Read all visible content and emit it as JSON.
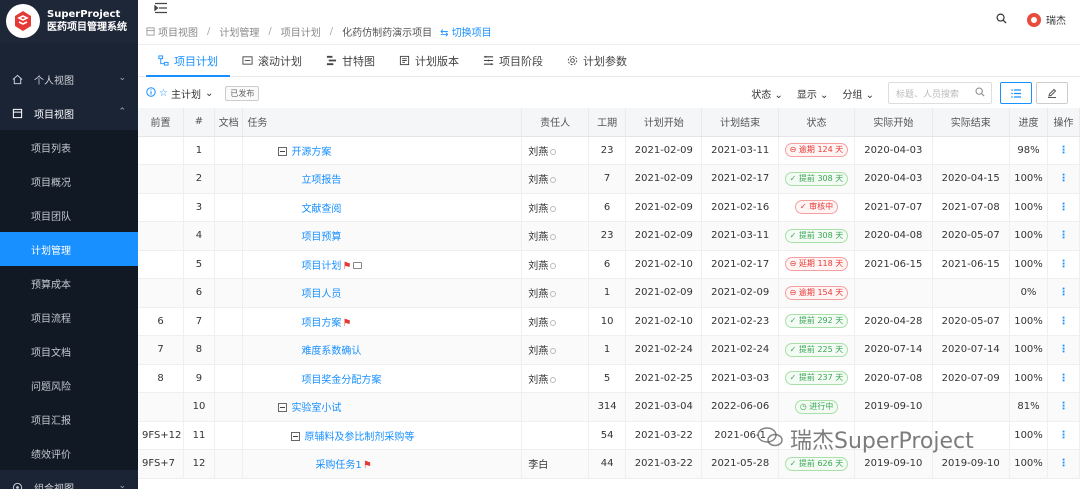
{
  "brand": {
    "name": "SuperProject",
    "subtitle": "医药项目管理系统"
  },
  "sidebar": {
    "groups": [
      {
        "label": "个人视图"
      },
      {
        "label": "项目视图"
      }
    ],
    "items": [
      {
        "label": "项目列表"
      },
      {
        "label": "项目概况"
      },
      {
        "label": "项目团队"
      },
      {
        "label": "计划管理"
      },
      {
        "label": "预算成本"
      },
      {
        "label": "项目流程"
      },
      {
        "label": "项目文档"
      },
      {
        "label": "问题风险"
      },
      {
        "label": "项目汇报"
      },
      {
        "label": "绩效评价"
      }
    ],
    "bottom_group": {
      "label": "组合视图"
    }
  },
  "breadcrumb": {
    "items": [
      "项目视图",
      "计划管理",
      "项目计划",
      "化药仿制药演示项目"
    ],
    "switch_label": "切换项目"
  },
  "user": {
    "name": "瑞杰"
  },
  "tabs": [
    {
      "label": "项目计划"
    },
    {
      "label": "滚动计划"
    },
    {
      "label": "甘特图"
    },
    {
      "label": "计划版本"
    },
    {
      "label": "项目阶段"
    },
    {
      "label": "计划参数"
    }
  ],
  "toolbar": {
    "plan_label": "主计划",
    "published_badge": "已发布",
    "status_filter": "状态",
    "display_filter": "显示",
    "group_filter": "分组",
    "search_placeholder": "标题、人员搜索"
  },
  "table": {
    "headers": {
      "pred": "前置",
      "num": "#",
      "doc": "文档",
      "task": "任务",
      "owner": "责任人",
      "duration": "工期",
      "plan_start": "计划开始",
      "plan_end": "计划结束",
      "status": "状态",
      "actual_start": "实际开始",
      "actual_end": "实际结束",
      "progress": "进度",
      "ops": "操作"
    },
    "rows": [
      {
        "pred": "",
        "num": "1",
        "task": "开源方案",
        "owner": "刘燕",
        "duration": "23",
        "plan_start": "2021-02-09",
        "plan_end": "2021-03-11",
        "status": "逾期 124 天",
        "status_color": "red",
        "actual_start": "2020-04-03",
        "actual_end": "",
        "progress": "98%"
      },
      {
        "pred": "",
        "num": "2",
        "task": "立项报告",
        "owner": "刘燕",
        "duration": "7",
        "plan_start": "2021-02-09",
        "plan_end": "2021-02-17",
        "status": "提前 308 天",
        "status_color": "green",
        "actual_start": "2020-04-03",
        "actual_end": "2020-04-15",
        "progress": "100%"
      },
      {
        "pred": "",
        "num": "3",
        "task": "文献查阅",
        "owner": "刘燕",
        "duration": "6",
        "plan_start": "2021-02-09",
        "plan_end": "2021-02-16",
        "status": "审核中",
        "status_color": "red",
        "actual_start": "2021-07-07",
        "actual_end": "2021-07-08",
        "progress": "100%"
      },
      {
        "pred": "",
        "num": "4",
        "task": "项目预算",
        "owner": "刘燕",
        "duration": "23",
        "plan_start": "2021-02-09",
        "plan_end": "2021-03-11",
        "status": "提前 308 天",
        "status_color": "green",
        "actual_start": "2020-04-08",
        "actual_end": "2020-05-07",
        "progress": "100%"
      },
      {
        "pred": "",
        "num": "5",
        "task": "项目计划",
        "owner": "刘燕",
        "duration": "6",
        "plan_start": "2021-02-10",
        "plan_end": "2021-02-17",
        "status": "延期 118 天",
        "status_color": "red",
        "actual_start": "2021-06-15",
        "actual_end": "2021-06-15",
        "progress": "100%"
      },
      {
        "pred": "",
        "num": "6",
        "task": "项目人员",
        "owner": "刘燕",
        "duration": "1",
        "plan_start": "2021-02-09",
        "plan_end": "2021-02-09",
        "status": "逾期 154 天",
        "status_color": "red",
        "actual_start": "",
        "actual_end": "",
        "progress": "0%"
      },
      {
        "pred": "6",
        "num": "7",
        "task": "项目方案",
        "owner": "刘燕",
        "duration": "10",
        "plan_start": "2021-02-10",
        "plan_end": "2021-02-23",
        "status": "提前 292 天",
        "status_color": "green",
        "actual_start": "2020-04-28",
        "actual_end": "2020-05-07",
        "progress": "100%"
      },
      {
        "pred": "7",
        "num": "8",
        "task": "难度系数确认",
        "owner": "刘燕",
        "duration": "1",
        "plan_start": "2021-02-24",
        "plan_end": "2021-02-24",
        "status": "提前 225 天",
        "status_color": "green",
        "actual_start": "2020-07-14",
        "actual_end": "2020-07-14",
        "progress": "100%"
      },
      {
        "pred": "8",
        "num": "9",
        "task": "项目奖金分配方案",
        "owner": "刘燕",
        "duration": "5",
        "plan_start": "2021-02-25",
        "plan_end": "2021-03-03",
        "status": "提前 237 天",
        "status_color": "green",
        "actual_start": "2020-07-08",
        "actual_end": "2020-07-09",
        "progress": "100%"
      },
      {
        "pred": "",
        "num": "10",
        "task": "实验室小试",
        "owner": "",
        "duration": "314",
        "plan_start": "2021-03-04",
        "plan_end": "2022-06-06",
        "status": "进行中",
        "status_color": "green",
        "actual_start": "2019-09-10",
        "actual_end": "",
        "progress": "81%"
      },
      {
        "pred": "9FS+12",
        "num": "11",
        "task": "原辅料及参比制剂采购等",
        "owner": "",
        "duration": "54",
        "plan_start": "2021-03-22",
        "plan_end": "2021-06-1",
        "status": "",
        "status_color": "red",
        "actual_start": "",
        "actual_end": "",
        "progress": "100%"
      },
      {
        "pred": "9FS+7",
        "num": "12",
        "task": "采购任务1",
        "owner": "李白",
        "duration": "44",
        "plan_start": "2021-03-22",
        "plan_end": "2021-05-28",
        "status": "提前 626 天",
        "status_color": "green",
        "actual_start": "2019-09-10",
        "actual_end": "2019-09-10",
        "progress": "100%"
      }
    ]
  },
  "watermark": {
    "text": "瑞杰SuperProject"
  }
}
